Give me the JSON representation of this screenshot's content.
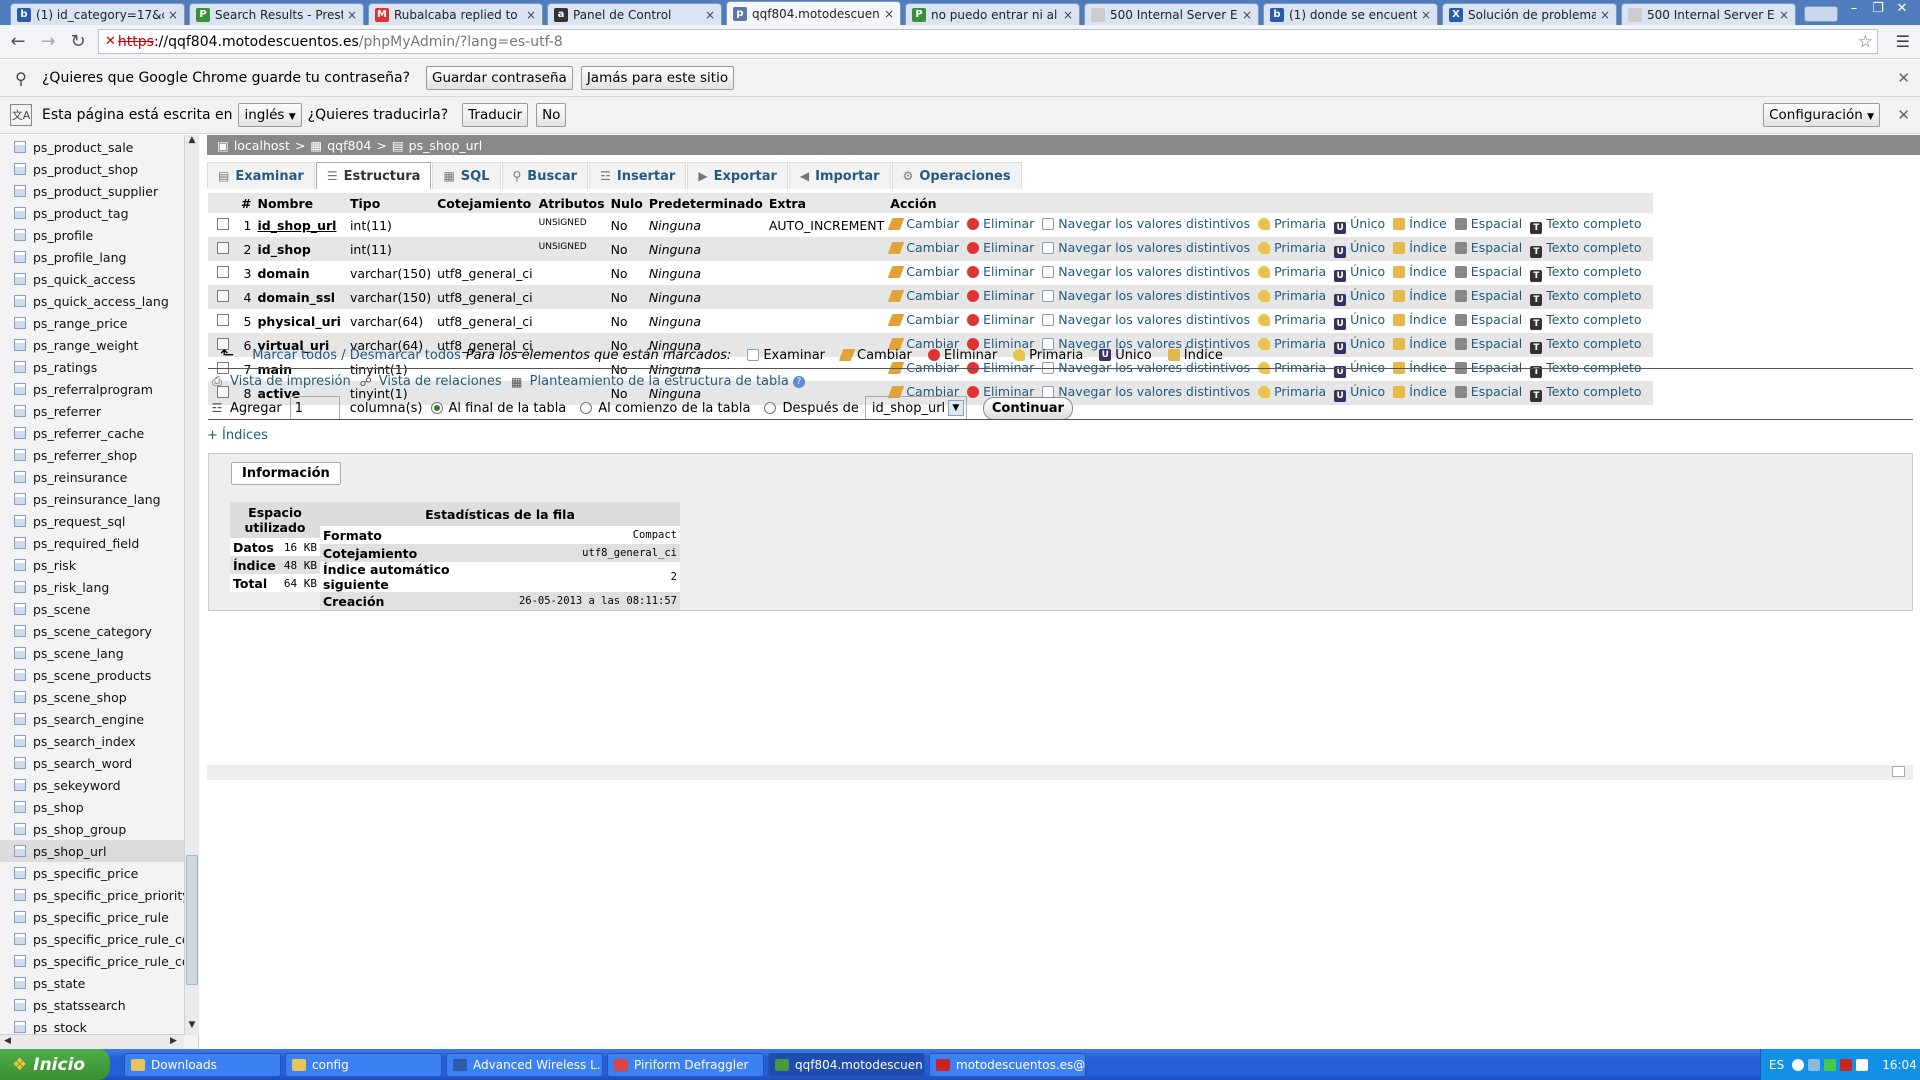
{
  "browser": {
    "tabs": [
      {
        "title": "(1) id_category=17&cont",
        "fav": "b",
        "color": "#2a5caa"
      },
      {
        "title": "Search Results - PrestaSh",
        "fav": "P",
        "color": "#3a8f3a"
      },
      {
        "title": "Rubalcaba replied to no p",
        "fav": "M",
        "color": "#d33"
      },
      {
        "title": "Panel de Control",
        "fav": "a",
        "color": "#333"
      },
      {
        "title": "qqf804.motodescuentos.",
        "fav": "p",
        "color": "#5b78a8",
        "active": true
      },
      {
        "title": "no puedo entrar ni al bac",
        "fav": "P",
        "color": "#3a8f3a"
      },
      {
        "title": "500 Internal Server Error",
        "fav": "",
        "color": "#ccc"
      },
      {
        "title": "(1) donde se encuentra e",
        "fav": "b",
        "color": "#2a5caa"
      },
      {
        "title": "Solución de problemas - P",
        "fav": "X",
        "color": "#2a5caa"
      },
      {
        "title": "500 Internal Server Error",
        "fav": "",
        "color": "#ccc"
      }
    ],
    "url_https": "https",
    "url_host": "://qqf804.motodescuentos.es",
    "url_path": "/phpMyAdmin/?lang=es-utf-8"
  },
  "password_bar": {
    "text": "¿Quieres que Google Chrome guarde tu contraseña?",
    "save": "Guardar contraseña",
    "never": "Jamás para este sitio"
  },
  "translate_bar": {
    "text": "Esta página está escrita en",
    "language": "inglés",
    "question": "¿Quieres traducirla?",
    "translate": "Traducir",
    "no": "No",
    "config": "Configuración"
  },
  "sidebar": {
    "tables": [
      "ps_product_sale",
      "ps_product_shop",
      "ps_product_supplier",
      "ps_product_tag",
      "ps_profile",
      "ps_profile_lang",
      "ps_quick_access",
      "ps_quick_access_lang",
      "ps_range_price",
      "ps_range_weight",
      "ps_ratings",
      "ps_referralprogram",
      "ps_referrer",
      "ps_referrer_cache",
      "ps_referrer_shop",
      "ps_reinsurance",
      "ps_reinsurance_lang",
      "ps_request_sql",
      "ps_required_field",
      "ps_risk",
      "ps_risk_lang",
      "ps_scene",
      "ps_scene_category",
      "ps_scene_lang",
      "ps_scene_products",
      "ps_scene_shop",
      "ps_search_engine",
      "ps_search_index",
      "ps_search_word",
      "ps_sekeyword",
      "ps_shop",
      "ps_shop_group",
      "ps_shop_url",
      "ps_specific_price",
      "ps_specific_price_priority",
      "ps_specific_price_rule",
      "ps_specific_price_rule_co",
      "ps_specific_price_rule_co",
      "ps_state",
      "ps_statssearch",
      "ps_stock"
    ],
    "selected": "ps_shop_url"
  },
  "breadcrumb": {
    "server": "localhost",
    "db": "qqf804",
    "table": "ps_shop_url"
  },
  "tabs": [
    "Examinar",
    "Estructura",
    "SQL",
    "Buscar",
    "Insertar",
    "Exportar",
    "Importar",
    "Operaciones"
  ],
  "active_tab": "Estructura",
  "columns": [
    "#",
    "Nombre",
    "Tipo",
    "Cotejamiento",
    "Atributos",
    "Nulo",
    "Predeterminado",
    "Extra",
    "Acción"
  ],
  "fields": [
    {
      "n": "1",
      "name": "id_shop_url",
      "type": "int(11)",
      "coll": "",
      "attr": "UNSIGNED",
      "null": "No",
      "def": "Ninguna",
      "extra": "AUTO_INCREMENT",
      "pk": true
    },
    {
      "n": "2",
      "name": "id_shop",
      "type": "int(11)",
      "coll": "",
      "attr": "UNSIGNED",
      "null": "No",
      "def": "Ninguna",
      "extra": ""
    },
    {
      "n": "3",
      "name": "domain",
      "type": "varchar(150)",
      "coll": "utf8_general_ci",
      "attr": "",
      "null": "No",
      "def": "Ninguna",
      "extra": ""
    },
    {
      "n": "4",
      "name": "domain_ssl",
      "type": "varchar(150)",
      "coll": "utf8_general_ci",
      "attr": "",
      "null": "No",
      "def": "Ninguna",
      "extra": ""
    },
    {
      "n": "5",
      "name": "physical_uri",
      "type": "varchar(64)",
      "coll": "utf8_general_ci",
      "attr": "",
      "null": "No",
      "def": "Ninguna",
      "extra": ""
    },
    {
      "n": "6",
      "name": "virtual_uri",
      "type": "varchar(64)",
      "coll": "utf8_general_ci",
      "attr": "",
      "null": "No",
      "def": "Ninguna",
      "extra": ""
    },
    {
      "n": "7",
      "name": "main",
      "type": "tinyint(1)",
      "coll": "",
      "attr": "",
      "null": "No",
      "def": "Ninguna",
      "extra": ""
    },
    {
      "n": "8",
      "name": "active",
      "type": "tinyint(1)",
      "coll": "",
      "attr": "",
      "null": "No",
      "def": "Ninguna",
      "extra": ""
    }
  ],
  "actions": [
    {
      "label": "Cambiar",
      "icon": "edit"
    },
    {
      "label": "Eliminar",
      "icon": "del"
    },
    {
      "label": "Navegar los valores distintivos",
      "icon": "browse"
    },
    {
      "label": "Primaria",
      "icon": "prim"
    },
    {
      "label": "Único",
      "icon": "uniq"
    },
    {
      "label": "Índice",
      "icon": "idx"
    },
    {
      "label": "Espacial",
      "icon": "spat"
    },
    {
      "label": "Texto completo",
      "icon": "ft"
    }
  ],
  "bulk": {
    "check_all": "Marcar todos",
    "sep": " / ",
    "uncheck_all": "Desmarcar todos",
    "for_selected": "Para los elementos que están marcados:",
    "actions": [
      {
        "label": "Examinar",
        "icon": "browse"
      },
      {
        "label": "Cambiar",
        "icon": "edit"
      },
      {
        "label": "Eliminar",
        "icon": "del"
      },
      {
        "label": "Primaria",
        "icon": "prim"
      },
      {
        "label": "Único",
        "icon": "uniq"
      },
      {
        "label": "Índice",
        "icon": "idx"
      }
    ]
  },
  "links": {
    "print": "Vista de impresión",
    "relations": "Vista de relaciones",
    "propose": "Planteamiento de la estructura de tabla"
  },
  "add": {
    "label": "Agregar",
    "count": "1",
    "columns": "columna(s)",
    "at_end": "Al final de la tabla",
    "at_begin": "Al comienzo de la tabla",
    "after": "Después de",
    "after_field": "id_shop_url",
    "go": "Continuar"
  },
  "indices_link": "+ Índices",
  "info": {
    "legend": "Información",
    "space_header": "Espacio utilizado",
    "space": [
      {
        "k": "Datos",
        "v": "16",
        "u": "KB"
      },
      {
        "k": "Índice",
        "v": "48",
        "u": "KB"
      },
      {
        "k": "Total",
        "v": "64",
        "u": "KB"
      }
    ],
    "stats_header": "Estadísticas de la fila",
    "stats": [
      {
        "k": "Formato",
        "v": "Compact"
      },
      {
        "k": "Cotejamiento",
        "v": "utf8_general_ci"
      },
      {
        "k": "Índice automático siguiente",
        "v": "2"
      },
      {
        "k": "Creación",
        "v": "26-05-2013 a las 08:11:57"
      }
    ]
  },
  "taskbar": {
    "start": "Inicio",
    "tasks": [
      {
        "label": "Downloads",
        "color": "#e8c45a"
      },
      {
        "label": "config",
        "color": "#e8c45a"
      },
      {
        "label": "Advanced Wireless L...",
        "color": "#2a5caa"
      },
      {
        "label": "Piriform Defraggler",
        "color": "#d44"
      },
      {
        "label": "qqf804.motodescuen...",
        "color": "#4a9a3a",
        "active": true
      },
      {
        "label": "motodescuentos.es@...",
        "color": "#c22"
      }
    ],
    "lang": "ES",
    "time": "16:04"
  }
}
